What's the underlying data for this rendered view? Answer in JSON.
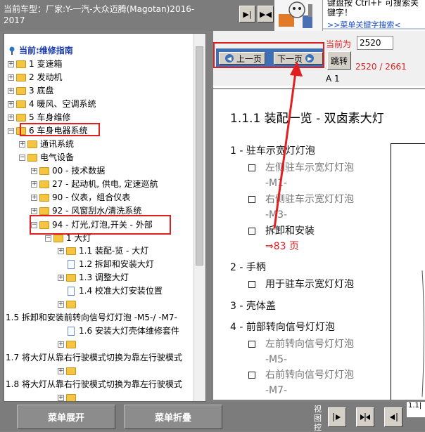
{
  "header": {
    "title": "当前车型：厂家:Y-一汽-大众迈腾(Magotan)2016-2017",
    "btn_prev": "▶|",
    "btn_next": "▶◀",
    "tip_line1": "键盘按 Ctrl+F 可搜索关键字！",
    "tip_line2": ">>菜单关键字搜索<"
  },
  "tree": {
    "root": "当前:维修指南",
    "items": [
      {
        "label": "1 变速箱"
      },
      {
        "label": "2 发动机"
      },
      {
        "label": "3 底盘"
      },
      {
        "label": "4 暖风、空调系统"
      },
      {
        "label": "5 车身维修"
      },
      {
        "label": "6 车身电器系统"
      },
      {
        "label": "通讯系统"
      },
      {
        "label": "电气设备"
      },
      {
        "label": "00 - 技术数据"
      },
      {
        "label": "27 - 起动机, 供电, 定速巡航"
      },
      {
        "label": "90 - 仪表，组合仪表"
      },
      {
        "label": "92 - 风窗刮水/清洗系统"
      },
      {
        "label": "94 - 灯光,灯泡,开关 - 外部"
      },
      {
        "label": "1 大灯"
      },
      {
        "label": "1.1 装配-览 - 大灯"
      },
      {
        "label": "1.2 拆卸和安装大灯"
      },
      {
        "label": "1.3 调整大灯"
      },
      {
        "label": "1.4 校准大灯安装位置"
      },
      {
        "label": "1.5 拆卸和安装前转向信号灯灯泡 -M5-/ -M7-"
      },
      {
        "label": "1.6 安装大灯壳体维修套件"
      },
      {
        "label": "1.7 将大灯从靠右行驶模式切换为靠左行驶模式"
      },
      {
        "label": "1.8 将大灯从靠右行驶模式切换为靠左行驶模式"
      }
    ]
  },
  "nav": {
    "prev_label": "上一页",
    "next_label": "下一页",
    "page_label": "当前为",
    "page_value": "2520",
    "jump_label": "跳转",
    "page_count": "2520 / 2661",
    "section": "A 1"
  },
  "document": {
    "title": "1.1.1 装配一览 - 双卤素大灯",
    "lines": [
      "1 - 驻车示宽灯灯泡",
      "左侧驻车示宽灯灯泡",
      "-M1-",
      "右侧驻车示宽灯灯泡",
      "-M3-",
      "拆卸和安装",
      "⇒83 页",
      "2 - 手柄",
      "用于驻车示宽灯灯泡",
      "3 - 壳体盖",
      "4 - 前部转向信号灯灯泡",
      "左前转向信号灯灯泡",
      "-M5-",
      "右前转向信号灯灯泡",
      "-M7-"
    ]
  },
  "footer": {
    "expand_label": "菜单展开",
    "collapse_label": "菜单折叠",
    "view_label": "视图控",
    "page_corner": "1.1|"
  },
  "colors": {
    "highlight_red": "#e02020",
    "nav_blue": "#3c6fb5",
    "folder_yellow": "#f4c542"
  }
}
